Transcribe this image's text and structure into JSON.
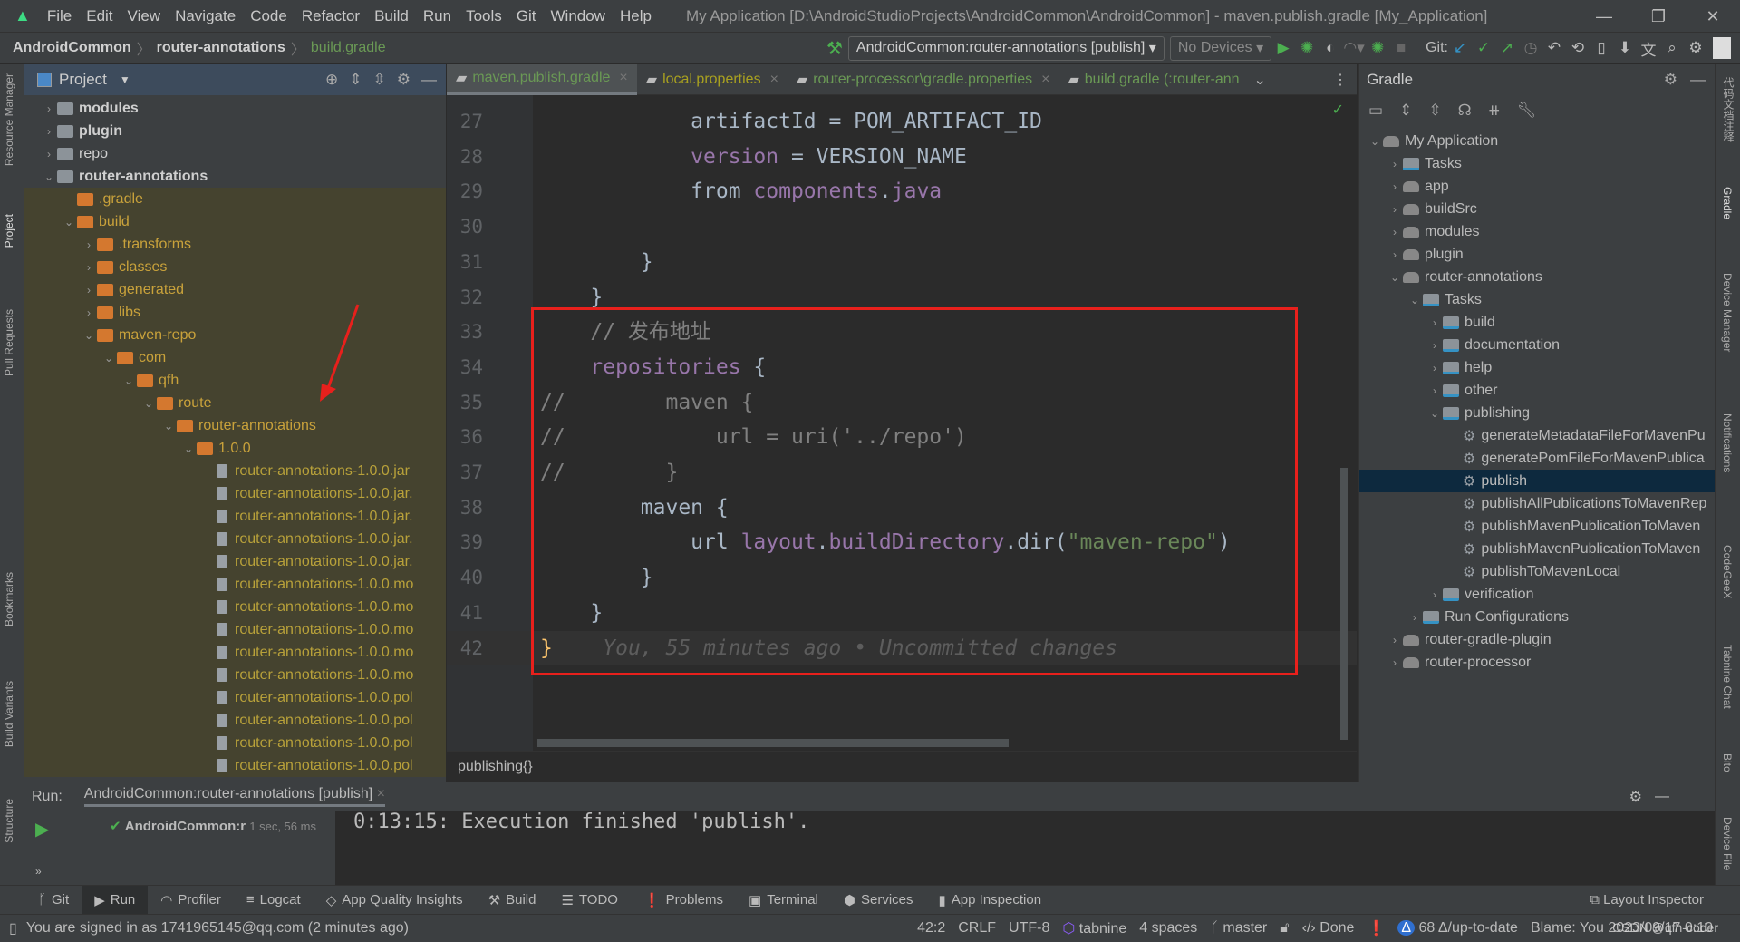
{
  "titlebar": {
    "menus": [
      "File",
      "Edit",
      "View",
      "Navigate",
      "Code",
      "Refactor",
      "Build",
      "Run",
      "Tools",
      "Git",
      "Window",
      "Help"
    ],
    "title": "My Application [D:\\AndroidStudioProjects\\AndroidCommon\\AndroidCommon] - maven.publish.gradle [My_Application]",
    "min": "—",
    "restore": "❐",
    "close": "✕"
  },
  "navbar": {
    "crumbs": [
      "AndroidCommon",
      "router-annotations",
      "build.gradle"
    ],
    "run_config": "AndroidCommon:router-annotations [publish]",
    "devices": "No Devices",
    "git_label": "Git:"
  },
  "side_left": [
    "Resource Manager",
    "Project",
    "Pull Requests",
    "Bookmarks",
    "Build Variants",
    "Structure"
  ],
  "side_right": [
    "代码文档注释",
    "Gradle",
    "Device Manager",
    "Notifications",
    "CodeGeeX",
    "Tabnine Chat",
    "Bito",
    "Device File"
  ],
  "project": {
    "title": "Project",
    "tree": [
      {
        "level": 0,
        "label": "modules",
        "type": "folder-grey",
        "arrow": "›",
        "bold": true
      },
      {
        "level": 0,
        "label": "plugin",
        "type": "folder-grey",
        "arrow": "›",
        "bold": true
      },
      {
        "level": 0,
        "label": "repo",
        "type": "folder-grey",
        "arrow": "›"
      },
      {
        "level": 0,
        "label": "router-annotations",
        "type": "folder-grey",
        "arrow": "⌄",
        "bold": true
      },
      {
        "level": 1,
        "label": ".gradle",
        "type": "folder-orange",
        "arrow": "",
        "ex": true
      },
      {
        "level": 1,
        "label": "build",
        "type": "folder-orange",
        "arrow": "⌄",
        "ex": true
      },
      {
        "level": 2,
        "label": ".transforms",
        "type": "folder-orange",
        "arrow": "›",
        "ex": true
      },
      {
        "level": 2,
        "label": "classes",
        "type": "folder-orange",
        "arrow": "›",
        "ex": true
      },
      {
        "level": 2,
        "label": "generated",
        "type": "folder-orange",
        "arrow": "›",
        "ex": true
      },
      {
        "level": 2,
        "label": "libs",
        "type": "folder-orange",
        "arrow": "›",
        "ex": true
      },
      {
        "level": 2,
        "label": "maven-repo",
        "type": "folder-orange",
        "arrow": "⌄",
        "ex": true
      },
      {
        "level": 3,
        "label": "com",
        "type": "folder-orange",
        "arrow": "⌄",
        "ex": true
      },
      {
        "level": 4,
        "label": "qfh",
        "type": "folder-orange",
        "arrow": "⌄",
        "ex": true
      },
      {
        "level": 5,
        "label": "route",
        "type": "folder-orange",
        "arrow": "⌄",
        "ex": true
      },
      {
        "level": 6,
        "label": "router-annotations",
        "type": "folder-orange",
        "arrow": "⌄",
        "ex": true
      },
      {
        "level": 7,
        "label": "1.0.0",
        "type": "folder-orange",
        "arrow": "⌄",
        "ex": true
      },
      {
        "level": 8,
        "label": "router-annotations-1.0.0.jar",
        "type": "file",
        "arrow": "",
        "ex": true
      },
      {
        "level": 8,
        "label": "router-annotations-1.0.0.jar.",
        "type": "file",
        "arrow": "",
        "ex": true
      },
      {
        "level": 8,
        "label": "router-annotations-1.0.0.jar.",
        "type": "file",
        "arrow": "",
        "ex": true
      },
      {
        "level": 8,
        "label": "router-annotations-1.0.0.jar.",
        "type": "file",
        "arrow": "",
        "ex": true
      },
      {
        "level": 8,
        "label": "router-annotations-1.0.0.jar.",
        "type": "file",
        "arrow": "",
        "ex": true
      },
      {
        "level": 8,
        "label": "router-annotations-1.0.0.mo",
        "type": "file",
        "arrow": "",
        "ex": true
      },
      {
        "level": 8,
        "label": "router-annotations-1.0.0.mo",
        "type": "file",
        "arrow": "",
        "ex": true
      },
      {
        "level": 8,
        "label": "router-annotations-1.0.0.mo",
        "type": "file",
        "arrow": "",
        "ex": true
      },
      {
        "level": 8,
        "label": "router-annotations-1.0.0.mo",
        "type": "file",
        "arrow": "",
        "ex": true
      },
      {
        "level": 8,
        "label": "router-annotations-1.0.0.mo",
        "type": "file",
        "arrow": "",
        "ex": true
      },
      {
        "level": 8,
        "label": "router-annotations-1.0.0.pol",
        "type": "file",
        "arrow": "",
        "ex": true
      },
      {
        "level": 8,
        "label": "router-annotations-1.0.0.pol",
        "type": "file",
        "arrow": "",
        "ex": true
      },
      {
        "level": 8,
        "label": "router-annotations-1.0.0.pol",
        "type": "file",
        "arrow": "",
        "ex": true
      },
      {
        "level": 8,
        "label": "router-annotations-1.0.0.pol",
        "type": "file",
        "arrow": "",
        "ex": true
      }
    ]
  },
  "editor": {
    "tabs": [
      {
        "label": "maven.publish.gradle",
        "color": "#6a9955",
        "active": true
      },
      {
        "label": "local.properties",
        "color": "#a8a020"
      },
      {
        "label": "router-processor\\gradle.properties",
        "color": "#6a9955"
      },
      {
        "label": "build.gradle (:router-ann",
        "color": "#6a9955"
      }
    ],
    "lines": [
      {
        "n": "27",
        "html": "            artifactId = POM_ARTIFACT_ID"
      },
      {
        "n": "28",
        "html": "            <span class='kw'>version</span> = VERSION_NAME"
      },
      {
        "n": "29",
        "html": "            from <span class='kw'>components</span>.<span class='kw'>java</span>"
      },
      {
        "n": "30",
        "html": ""
      },
      {
        "n": "31",
        "html": "        }"
      },
      {
        "n": "32",
        "html": "    }"
      },
      {
        "n": "33",
        "html": "    <span class='cm'>// 发布地址</span>"
      },
      {
        "n": "34",
        "html": "    <span class='kw'>repositories</span> {"
      },
      {
        "n": "35",
        "html": "<span class='cm'>//        maven {</span>"
      },
      {
        "n": "36",
        "html": "<span class='cm'>//            url = uri('../repo')</span>"
      },
      {
        "n": "37",
        "html": "<span class='cm'>//        }</span>"
      },
      {
        "n": "38",
        "html": "        maven {"
      },
      {
        "n": "39",
        "html": "            url <span class='kw'>layout</span>.<span class='kw'>buildDirectory</span>.dir(<span class='str'>\"maven-repo\"</span>)"
      },
      {
        "n": "40",
        "html": "        }"
      },
      {
        "n": "41",
        "html": "    }"
      },
      {
        "n": "42",
        "html": "<span class='fn'>}</span>    <span class='blame'>You, 55 minutes ago • Uncommitted changes</span>"
      }
    ],
    "breadcrumb": "publishing{}"
  },
  "gradle": {
    "title": "Gradle",
    "tree": [
      {
        "level": 0,
        "label": "My Application",
        "icon": "eleph",
        "arrow": "⌄"
      },
      {
        "level": 1,
        "label": "Tasks",
        "icon": "folder",
        "arrow": "›"
      },
      {
        "level": 1,
        "label": "app",
        "icon": "eleph",
        "arrow": "›"
      },
      {
        "level": 1,
        "label": "buildSrc",
        "icon": "eleph",
        "arrow": "›"
      },
      {
        "level": 1,
        "label": "modules",
        "icon": "eleph",
        "arrow": "›"
      },
      {
        "level": 1,
        "label": "plugin",
        "icon": "eleph",
        "arrow": "›"
      },
      {
        "level": 1,
        "label": "router-annotations",
        "icon": "eleph",
        "arrow": "⌄"
      },
      {
        "level": 2,
        "label": "Tasks",
        "icon": "folder",
        "arrow": "⌄"
      },
      {
        "level": 3,
        "label": "build",
        "icon": "folder",
        "arrow": "›"
      },
      {
        "level": 3,
        "label": "documentation",
        "icon": "folder",
        "arrow": "›"
      },
      {
        "level": 3,
        "label": "help",
        "icon": "folder",
        "arrow": "›"
      },
      {
        "level": 3,
        "label": "other",
        "icon": "folder",
        "arrow": "›"
      },
      {
        "level": 3,
        "label": "publishing",
        "icon": "folder",
        "arrow": "⌄"
      },
      {
        "level": 4,
        "label": "generateMetadataFileForMavenPu",
        "icon": "gear",
        "arrow": ""
      },
      {
        "level": 4,
        "label": "generatePomFileForMavenPublica",
        "icon": "gear",
        "arrow": ""
      },
      {
        "level": 4,
        "label": "publish",
        "icon": "gear",
        "arrow": "",
        "selected": true
      },
      {
        "level": 4,
        "label": "publishAllPublicationsToMavenRep",
        "icon": "gear",
        "arrow": ""
      },
      {
        "level": 4,
        "label": "publishMavenPublicationToMaven",
        "icon": "gear",
        "arrow": ""
      },
      {
        "level": 4,
        "label": "publishMavenPublicationToMaven",
        "icon": "gear",
        "arrow": ""
      },
      {
        "level": 4,
        "label": "publishToMavenLocal",
        "icon": "gear",
        "arrow": ""
      },
      {
        "level": 3,
        "label": "verification",
        "icon": "folder",
        "arrow": "›"
      },
      {
        "level": 2,
        "label": "Run Configurations",
        "icon": "folder",
        "arrow": "›"
      },
      {
        "level": 1,
        "label": "router-gradle-plugin",
        "icon": "eleph",
        "arrow": "›"
      },
      {
        "level": 1,
        "label": "router-processor",
        "icon": "eleph",
        "arrow": "›"
      }
    ]
  },
  "run": {
    "label": "Run:",
    "tab": "AndroidCommon:router-annotations [publish]",
    "item": "AndroidCommon:r",
    "time": "1 sec, 56 ms",
    "output": "0:13:15: Execution finished 'publish'."
  },
  "bottom_tabs": [
    {
      "icon": "ᚴ",
      "label": "Git"
    },
    {
      "icon": "▶",
      "label": "Run",
      "active": true
    },
    {
      "icon": "◠",
      "label": "Profiler"
    },
    {
      "icon": "≡",
      "label": "Logcat"
    },
    {
      "icon": "◇",
      "label": "App Quality Insights"
    },
    {
      "icon": "⚒",
      "label": "Build"
    },
    {
      "icon": "☰",
      "label": "TODO"
    },
    {
      "icon": "❗",
      "label": "Problems"
    },
    {
      "icon": "▣",
      "label": "Terminal"
    },
    {
      "icon": "⬢",
      "label": "Services"
    },
    {
      "icon": "▮",
      "label": "App Inspection"
    }
  ],
  "layout_inspector": "Layout Inspector",
  "status": {
    "message": "You are signed in as 1741965145@qq.com (2 minutes ago)",
    "position": "42:2",
    "line_sep": "CRLF",
    "encoding": "UTF-8",
    "tabnine": "tabnine",
    "indent": "4 spaces",
    "branch": "master",
    "done": "Done",
    "changes": "68 Δ/up-to-date",
    "blame": "Blame: You 2023/09/17 0:10",
    "watermark": "CSDN @qfh-coder"
  }
}
